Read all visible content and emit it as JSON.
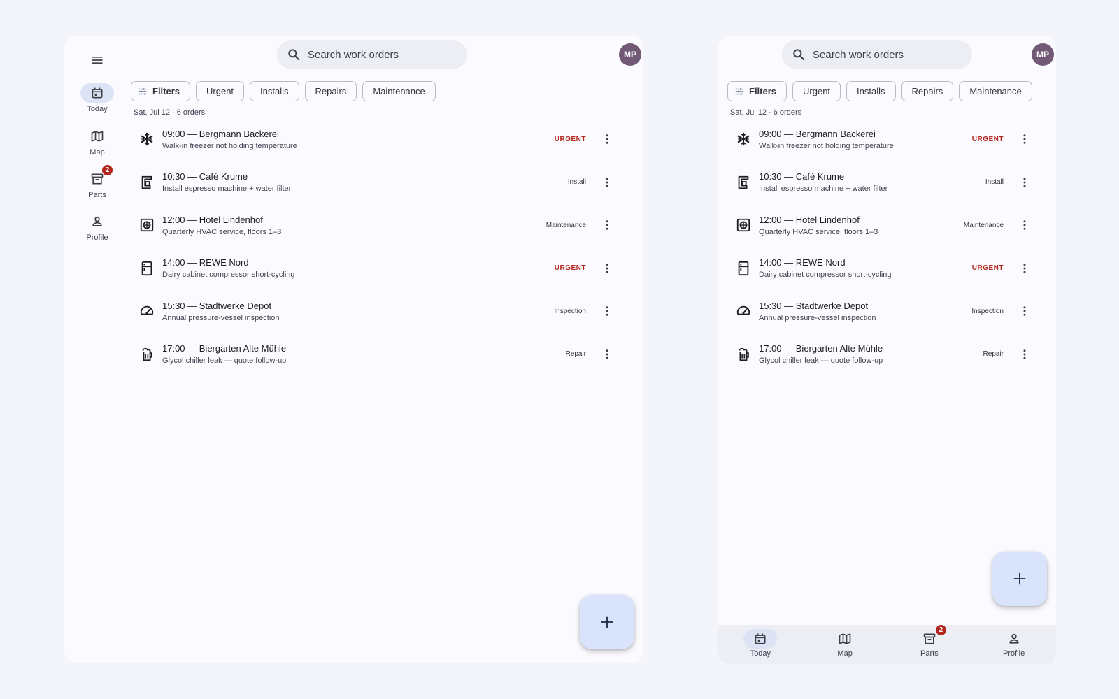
{
  "app": {
    "search_placeholder": "Search work orders",
    "avatar_initials": "MP",
    "date_line": "Sat, Jul 12 · 6 orders",
    "colors": {
      "accent": "#dce3f5",
      "urgent": "#b3261e",
      "avatar": "#725a77",
      "fab": "#d9e3fb"
    }
  },
  "nav": {
    "items": [
      {
        "label": "Today",
        "icon": "calendar-icon",
        "active": true,
        "badge": ""
      },
      {
        "label": "Map",
        "icon": "map-icon",
        "active": false,
        "badge": ""
      },
      {
        "label": "Parts",
        "icon": "archive-box-icon",
        "active": false,
        "badge": "2"
      },
      {
        "label": "Profile",
        "icon": "person-icon",
        "active": false,
        "badge": ""
      }
    ]
  },
  "filters": {
    "chips": [
      {
        "label": "Filters",
        "icon": "tune-icon"
      },
      {
        "label": "Urgent"
      },
      {
        "label": "Installs"
      },
      {
        "label": "Repairs"
      },
      {
        "label": "Maintenance"
      }
    ]
  },
  "orders": [
    {
      "title": "09:00 — Bergmann Bäckerei",
      "subtitle": "Walk-in freezer not holding temperature",
      "tag": "URGENT",
      "urgent": true,
      "icon": "snowflake-icon"
    },
    {
      "title": "10:30 — Café Krume",
      "subtitle": "Install espresso machine + water filter",
      "tag": "Install",
      "urgent": false,
      "icon": "coffee-maker-icon"
    },
    {
      "title": "12:00 — Hotel Lindenhof",
      "subtitle": "Quarterly HVAC service, floors 1–3",
      "tag": "Maintenance",
      "urgent": false,
      "icon": "hvac-unit-icon"
    },
    {
      "title": "14:00 — REWE Nord",
      "subtitle": "Dairy cabinet compressor short-cycling",
      "tag": "URGENT",
      "urgent": true,
      "icon": "fridge-icon"
    },
    {
      "title": "15:30 — Stadtwerke Depot",
      "subtitle": "Annual pressure-vessel inspection",
      "tag": "Inspection",
      "urgent": false,
      "icon": "gauge-icon"
    },
    {
      "title": "17:00 — Biergarten Alte Mühle",
      "subtitle": "Glycol chiller leak — quote follow-up",
      "tag": "Repair",
      "urgent": false,
      "icon": "beer-mug-icon"
    }
  ]
}
